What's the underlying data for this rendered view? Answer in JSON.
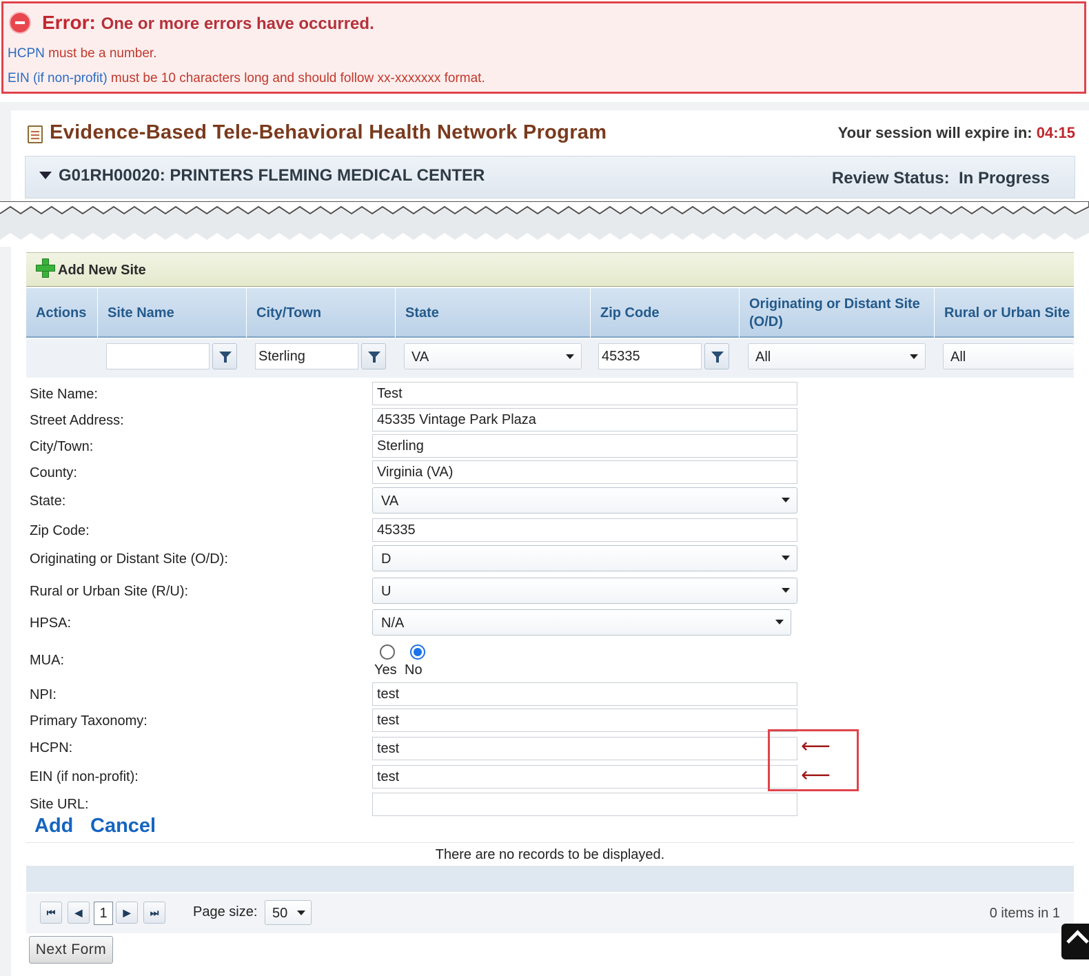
{
  "error": {
    "title": "Error:",
    "message": "One or more errors have occurred.",
    "lines": [
      {
        "field": "HCPN",
        "text": " must be a number."
      },
      {
        "field": "EIN (if non-profit)",
        "text": " must be 10 characters long and should follow xx-xxxxxxx format."
      }
    ]
  },
  "header": {
    "program_title": "Evidence-Based Tele-Behavioral Health Network Program",
    "session_label": "Your session will expire in: ",
    "session_time": "04:15",
    "grant_title": "G01RH00020: PRINTERS FLEMING MEDICAL CENTER",
    "review_label": "Review Status:",
    "review_value": "In Progress"
  },
  "grid": {
    "add_label": "Add New Site",
    "columns": [
      "Actions",
      "Site Name",
      "City/Town",
      "State",
      "Zip Code",
      "Originating or Distant Site (O/D)",
      "Rural or Urban Site"
    ],
    "filters": {
      "site_name": "",
      "city": "Sterling",
      "state": "VA",
      "zip": "45335",
      "od": "All",
      "ru": "All"
    },
    "no_records": "There are no records to be displayed.",
    "page_number": "1",
    "page_size_label": "Page size:",
    "page_size": "50",
    "items_info": "0 items in 1"
  },
  "form": {
    "labels": {
      "site_name": "Site Name:",
      "street": "Street Address:",
      "city": "City/Town:",
      "county": "County:",
      "state": "State:",
      "zip": "Zip Code:",
      "od": "Originating or Distant Site (O/D):",
      "ru": "Rural or Urban Site (R/U):",
      "hpsa": "HPSA:",
      "mua": "MUA:",
      "npi": "NPI:",
      "taxonomy": "Primary Taxonomy:",
      "hcpn": "HCPN:",
      "ein": "EIN (if non-profit):",
      "url": "Site URL:"
    },
    "values": {
      "site_name": "Test",
      "street": "45335 Vintage Park Plaza",
      "city": "Sterling",
      "county": "Virginia (VA)",
      "state": "VA",
      "zip": "45335",
      "od": "D",
      "ru": "U",
      "hpsa": "N/A",
      "mua_yes": "Yes",
      "mua_no": "No",
      "mua_selected": "No",
      "npi": "test",
      "taxonomy": "test",
      "hcpn": "test",
      "ein": "test",
      "url": ""
    },
    "add_label": "Add",
    "cancel_label": "Cancel"
  },
  "annotations": {
    "arrow": "⟵"
  },
  "footer": {
    "next_label": "Next Form"
  },
  "colors": {
    "error_border": "#e0434b",
    "link_blue": "#1565c0",
    "title_brown": "#7a3a1d"
  }
}
